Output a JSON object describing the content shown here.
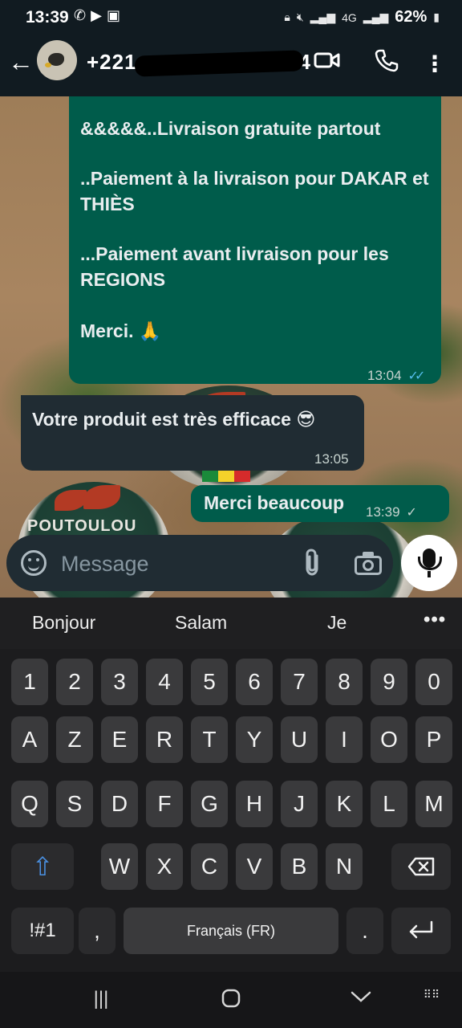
{
  "status_bar": {
    "time": "13:39",
    "network_label": "4G",
    "battery": "62%"
  },
  "header": {
    "contact_number": "+221",
    "contact_suffix": "24"
  },
  "messages": [
    {
      "direction": "outgoing",
      "paragraphs": [
        "&&&&&..Livraison gratuite partout",
        "..Paiement à la livraison pour DAKAR et THIÈS",
        "...Paiement avant livraison pour les REGIONS",
        "\nMerci. 🙏"
      ],
      "time": "13:04",
      "status": "read"
    },
    {
      "direction": "incoming",
      "text": "Votre produit est très efficace 😎",
      "time": "13:05"
    },
    {
      "direction": "outgoing",
      "text": "Merci beaucoup",
      "time": "13:39",
      "status": "sent"
    }
  ],
  "background_brand": "POUTOULOU",
  "input": {
    "placeholder": "Message"
  },
  "keyboard": {
    "suggestions": [
      "Bonjour",
      "Salam",
      "Je"
    ],
    "more": "•••",
    "row_numbers": [
      "1",
      "2",
      "3",
      "4",
      "5",
      "6",
      "7",
      "8",
      "9",
      "0"
    ],
    "row1": [
      "A",
      "Z",
      "E",
      "R",
      "T",
      "Y",
      "U",
      "I",
      "O",
      "P"
    ],
    "row2": [
      "Q",
      "S",
      "D",
      "F",
      "G",
      "H",
      "J",
      "K",
      "L",
      "M"
    ],
    "row3": [
      "W",
      "X",
      "C",
      "V",
      "B",
      "N"
    ],
    "symbols_key": "!#1",
    "comma_key": ",",
    "space_label": "Français (FR)",
    "period_key": "."
  },
  "colors": {
    "outgoing_bubble": "#005c4b",
    "incoming_bubble": "#202c33",
    "read_ticks": "#53bdeb"
  }
}
